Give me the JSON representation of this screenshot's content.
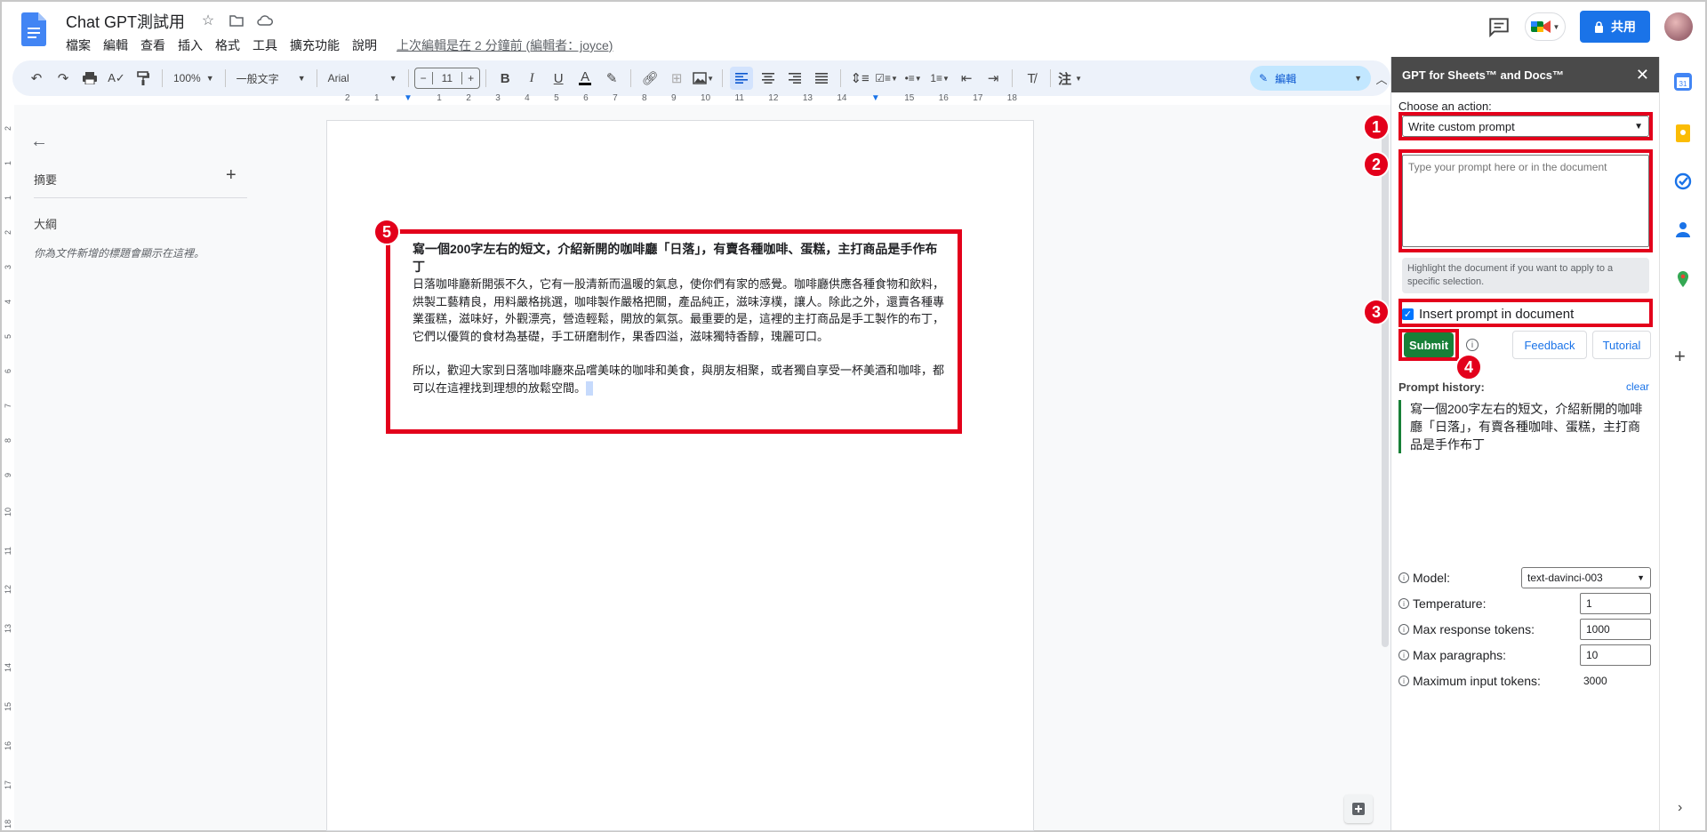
{
  "doc": {
    "title": "Chat GPT測試用",
    "menu": [
      "檔案",
      "編輯",
      "查看",
      "插入",
      "格式",
      "工具",
      "擴充功能",
      "說明"
    ],
    "last_edit": "上次編輯是在 2 分鐘前 (編輯者：joyce)",
    "share_label": "共用"
  },
  "toolbar": {
    "zoom": "100%",
    "style": "一般文字",
    "font": "Arial",
    "font_size": "11",
    "minus": "−",
    "plus": "+",
    "mode_label": "編輯"
  },
  "rulers": {
    "horizontal": [
      "2",
      "1",
      "1",
      "2",
      "3",
      "4",
      "5",
      "6",
      "7",
      "8",
      "9",
      "10",
      "11",
      "12",
      "13",
      "14",
      "15",
      "16",
      "17",
      "18"
    ],
    "vertical": [
      "2",
      "1",
      "1",
      "2",
      "3",
      "4",
      "5",
      "6",
      "7",
      "8",
      "9",
      "10",
      "11",
      "12",
      "13",
      "14",
      "15",
      "16",
      "17",
      "18"
    ]
  },
  "outline": {
    "summary_label": "摘要",
    "outline_label": "大綱",
    "note": "你為文件新增的標題會顯示在這裡。"
  },
  "page": {
    "heading": "寫一個200字左右的短文，介紹新開的咖啡廳「日落」，有賣各種咖啡、蛋糕，主打商品是手作布丁",
    "para1": "日落咖啡廳新開張不久，它有一股清新而溫暖的氣息，使你們有家的感覺。咖啡廳供應各種食物和飲料，烘製工藝精良，用料嚴格挑選，咖啡製作嚴格把關，產品純正，滋味淳樸，讓人。除此之外，還賣各種專業蛋糕，滋味好，外觀漂亮，營造輕鬆，開放的氣氛。最重要的是，這裡的主打商品是手工製作的布丁，它們以優質的食材為基礎，手工研磨制作，果香四溢，滋味獨特香醇，瑰麗可口。",
    "para2": "所以，歡迎大家到日落咖啡廳來品嚐美味的咖啡和美食，與朋友相聚，或者獨自享受一杯美酒和咖啡，都可以在這裡找到理想的放鬆空間。"
  },
  "annotations": [
    "1",
    "2",
    "3",
    "4",
    "5"
  ],
  "panel": {
    "title": "GPT for Sheets™ and Docs™",
    "close": "✕",
    "choose_label": "Choose an action:",
    "action_value": "Write custom prompt",
    "prompt_placeholder": "Type your prompt here or in the document",
    "hint": "Highlight the document if you want to apply to a specific selection.",
    "insert_label": "Insert prompt in document",
    "submit": "Submit",
    "feedback": "Feedback",
    "tutorial": "Tutorial",
    "history_label": "Prompt history:",
    "clear": "clear",
    "history_item": "寫一個200字左右的短文，介紹新開的咖啡廳「日落」，有賣各種咖啡、蛋糕，主打商品是手作布丁",
    "settings": {
      "model_label": "Model:",
      "model_value": "text-davinci-003",
      "temperature_label": "Temperature:",
      "temperature_value": "1",
      "max_tokens_label": "Max response tokens:",
      "max_tokens_value": "1000",
      "max_paragraphs_label": "Max paragraphs:",
      "max_paragraphs_value": "10",
      "max_input_label": "Maximum input tokens:",
      "max_input_value": "3000"
    }
  },
  "colors": {
    "accent": "#1a73e8",
    "annotation_red": "#e3001b",
    "submit_green": "#188038",
    "panel_header": "#4a4a4a"
  }
}
